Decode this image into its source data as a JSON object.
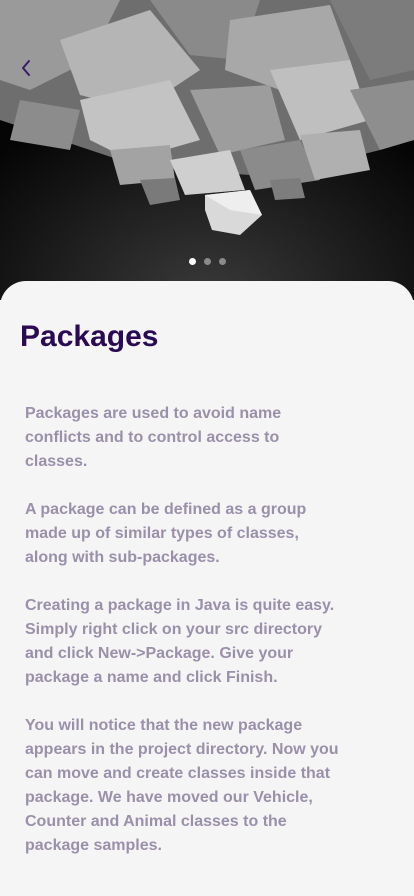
{
  "hero": {
    "image_description_icon": "abstract-cubes-image",
    "carousel": {
      "count": 3,
      "active_index": 0
    }
  },
  "header": {
    "back_icon": "chevron-left-icon"
  },
  "content": {
    "title": "Packages",
    "paragraphs": [
      "Packages are used to avoid name conflicts and to control access to classes.",
      "A package can be defined as a group made up of similar types of classes, along with sub-packages.",
      "Creating a package in Java is quite easy. Simply right click on your src directory and click New->Package. Give your package a name and click Finish.",
      "You will notice that the new package appears in the project directory. Now you can move and create classes inside that package. We have moved our Vehicle, Counter and Animal classes to the package samples."
    ]
  },
  "colors": {
    "title": "#2a0a52",
    "body_text": "#9b90aa",
    "back_icon": "#3a1a6a",
    "background": "#f5f5f5"
  }
}
